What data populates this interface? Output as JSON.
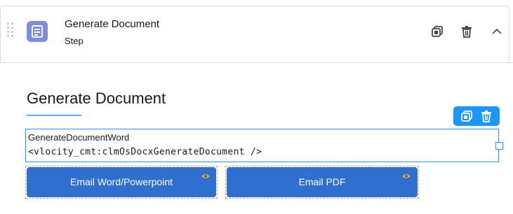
{
  "step": {
    "title": "Generate Document",
    "subtitle": "Step"
  },
  "section": {
    "title": "Generate Document"
  },
  "text_block": {
    "line1": "GenerateDocumentWord",
    "line2": "<vlocity_cmt:clmOsDocxGenerateDocument />"
  },
  "buttons": {
    "email_word": "Email Word/Powerpoint",
    "email_pdf": "Email PDF"
  },
  "colors": {
    "accent": "#1b96ff",
    "button": "#2e6fd0",
    "step_icon": "#7f8de1",
    "eye_icon": "#f5a623"
  },
  "icons": {
    "step": "document-icon",
    "clone": "clone-icon",
    "delete": "trash-icon",
    "collapse": "chevron-up-icon",
    "visibility": "eye-icon"
  }
}
